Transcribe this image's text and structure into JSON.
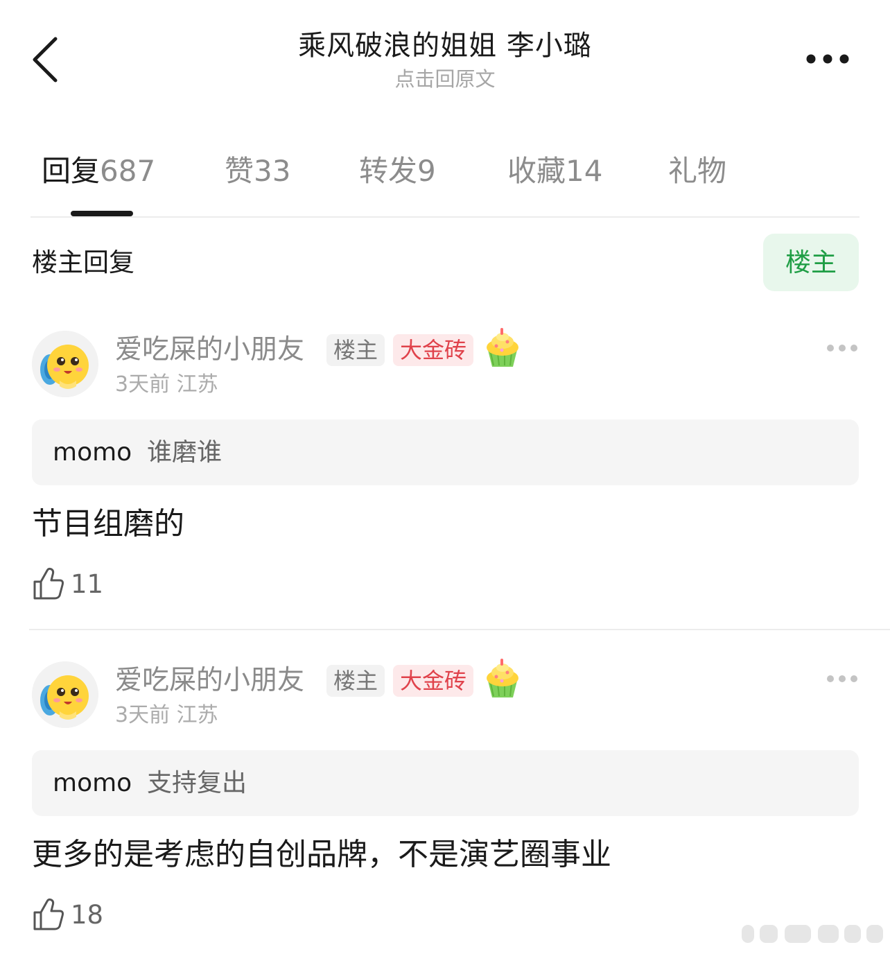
{
  "header": {
    "title": "乘风破浪的姐姐 李小璐",
    "subtitle": "点击回原文",
    "back_icon": "chevron-left-icon",
    "more_icon": "more-horizontal-icon"
  },
  "tabs": [
    {
      "label": "回复",
      "count": "687",
      "active": true
    },
    {
      "label": "赞",
      "count": "33",
      "active": false
    },
    {
      "label": "转发",
      "count": "9",
      "active": false
    },
    {
      "label": "收藏",
      "count": "14",
      "active": false
    },
    {
      "label": "礼物",
      "count": "",
      "active": false
    }
  ],
  "filter": {
    "section_title": "楼主回复",
    "button_label": "楼主",
    "button_bg": "#e8f7ec",
    "button_color": "#1f9e45"
  },
  "comments": [
    {
      "username": "爱吃屎的小朋友",
      "badge_op": "楼主",
      "badge_gold": "大金砖",
      "badge_icon": "cupcake-icon",
      "meta": "3天前 江苏",
      "quote_user": "momo",
      "quote_text": "谁磨谁",
      "text": "节目组磨的",
      "likes": "11"
    },
    {
      "username": "爱吃屎的小朋友",
      "badge_op": "楼主",
      "badge_gold": "大金砖",
      "badge_icon": "cupcake-icon",
      "meta": "3天前 江苏",
      "quote_user": "momo",
      "quote_text": "支持复出",
      "text": "更多的是考虑的自创品牌，不是演艺圈事业",
      "likes": "18"
    }
  ],
  "colors": {
    "text_primary": "#1a1a1a",
    "text_secondary": "#8a8a8a",
    "badge_gold_bg": "#fde9ea",
    "badge_gold_fg": "#e0424b",
    "quote_bg": "#f5f5f5"
  }
}
